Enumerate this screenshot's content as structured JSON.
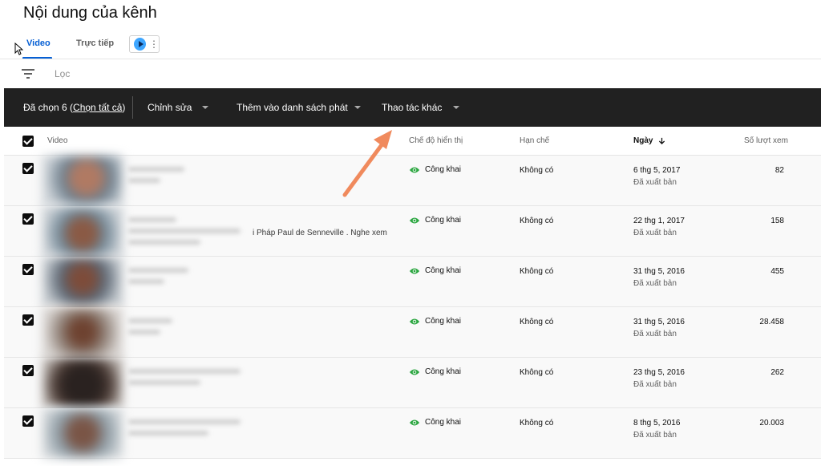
{
  "page": {
    "title": "Nội dung của kênh"
  },
  "tabs": [
    {
      "label": "Video",
      "active": true
    },
    {
      "label": "Trực tiếp",
      "active": false
    }
  ],
  "filter": {
    "placeholder": "Lọc"
  },
  "action_bar": {
    "selected_prefix": "Đã chọn 6 (",
    "select_all": "Chọn tất cả",
    "selected_suffix": ")",
    "edit": "Chỉnh sửa",
    "add_to_playlist": "Thêm vào danh sách phát",
    "more_actions": "Thao tác khác"
  },
  "table": {
    "headers": {
      "video": "Video",
      "visibility": "Chế độ hiển thị",
      "restrictions": "Hạn chế",
      "date": "Ngày",
      "views": "Số lượt xem"
    },
    "rows": [
      {
        "description": "",
        "visibility": "Công khai",
        "restrictions": "Không có",
        "date": "6 thg 5, 2017",
        "status": "Đã xuất bản",
        "views": "82"
      },
      {
        "description": "i Pháp Paul de Senneville . Nghe xem",
        "visibility": "Công khai",
        "restrictions": "Không có",
        "date": "22 thg 1, 2017",
        "status": "Đã xuất bản",
        "views": "158"
      },
      {
        "description": "",
        "visibility": "Công khai",
        "restrictions": "Không có",
        "date": "31 thg 5, 2016",
        "status": "Đã xuất bản",
        "views": "455"
      },
      {
        "description": "",
        "visibility": "Công khai",
        "restrictions": "Không có",
        "date": "31 thg 5, 2016",
        "status": "Đã xuất bản",
        "views": "28.458"
      },
      {
        "description": "",
        "visibility": "Công khai",
        "restrictions": "Không có",
        "date": "23 thg 5, 2016",
        "status": "Đã xuất bản",
        "views": "262"
      },
      {
        "description": "",
        "visibility": "Công khai",
        "restrictions": "Không có",
        "date": "8 thg 5, 2016",
        "status": "Đã xuất bản",
        "views": "20.003"
      }
    ]
  },
  "colors": {
    "accent": "#065fd4",
    "action_bar_bg": "#212121",
    "public_icon": "#2ba640",
    "annotation_arrow": "#f08a5d"
  },
  "icons": {
    "filter": "filter-icon",
    "sort": "arrow-down-icon",
    "visibility": "eye-icon",
    "live": "live-stream-icon",
    "caret": "caret-down-icon"
  }
}
